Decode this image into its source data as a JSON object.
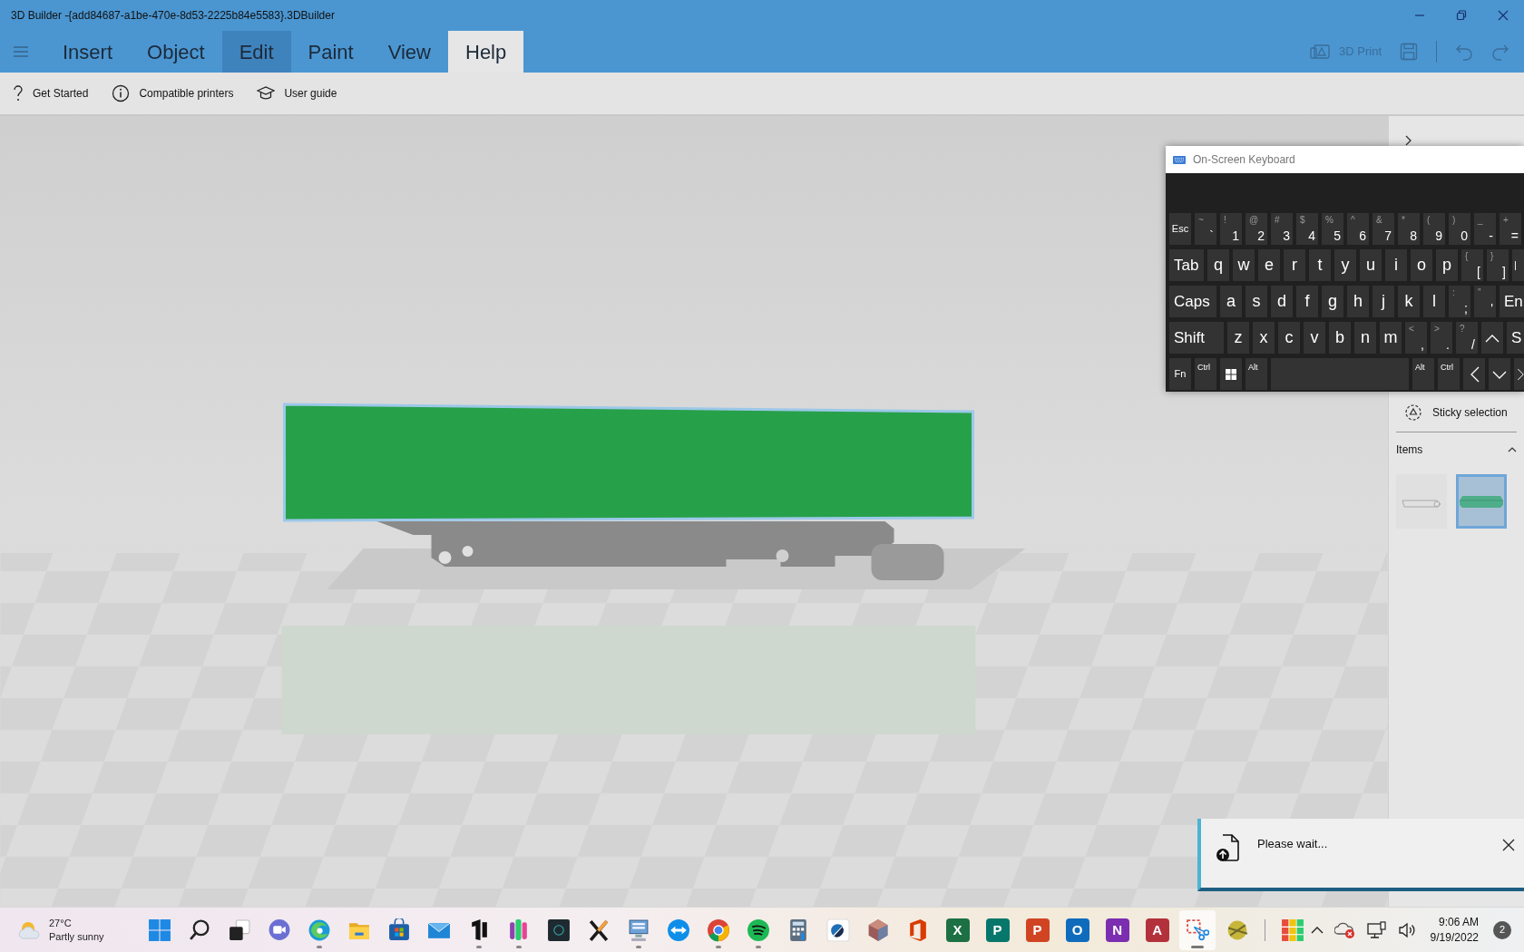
{
  "window": {
    "title": "3D Builder -{add84687-a1be-470e-8d53-2225b84e5583}.3DBuilder"
  },
  "tabs": [
    {
      "label": "Insert",
      "selected": false,
      "highlighted": false
    },
    {
      "label": "Object",
      "selected": false,
      "highlighted": false
    },
    {
      "label": "Edit",
      "selected": false,
      "highlighted": true
    },
    {
      "label": "Paint",
      "selected": false,
      "highlighted": false
    },
    {
      "label": "View",
      "selected": false,
      "highlighted": false
    },
    {
      "label": "Help",
      "selected": true,
      "highlighted": false
    }
  ],
  "quick_actions": [
    {
      "kind": "print",
      "label": "3D Print",
      "disabled": true
    },
    {
      "kind": "save",
      "disabled": true
    },
    {
      "kind": "undo",
      "disabled": true
    },
    {
      "kind": "redo",
      "disabled": true
    }
  ],
  "toolbar": [
    {
      "kind": "help",
      "label": "Get Started"
    },
    {
      "kind": "info",
      "label": "Compatible printers"
    },
    {
      "kind": "guide",
      "label": "User guide"
    }
  ],
  "side_panel": {
    "option": "Sticky selection",
    "items_title": "Items",
    "items_expanded": true,
    "items": [
      {
        "kind": "car",
        "selected": false
      },
      {
        "kind": "block",
        "selected": true
      }
    ]
  },
  "keyboard": {
    "title": "On-Screen Keyboard",
    "rows": [
      [
        {
          "kind": "small",
          "label": "Esc"
        },
        {
          "kind": "dual",
          "shift": "~",
          "label": "`"
        },
        {
          "kind": "dual",
          "shift": "!",
          "label": "1"
        },
        {
          "kind": "dual",
          "shift": "@",
          "label": "2"
        },
        {
          "kind": "dual",
          "shift": "#",
          "label": "3"
        },
        {
          "kind": "dual",
          "shift": "$",
          "label": "4"
        },
        {
          "kind": "dual",
          "shift": "%",
          "label": "5"
        },
        {
          "kind": "dual",
          "shift": "^",
          "label": "6"
        },
        {
          "kind": "dual",
          "shift": "&",
          "label": "7"
        },
        {
          "kind": "dual",
          "shift": "*",
          "label": "8"
        },
        {
          "kind": "dual",
          "shift": "(",
          "label": "9"
        },
        {
          "kind": "dual",
          "shift": ")",
          "label": "0"
        },
        {
          "kind": "dual",
          "shift": "_",
          "label": "-"
        },
        {
          "kind": "dual",
          "shift": "+",
          "label": "="
        }
      ],
      [
        {
          "kind": "mod",
          "label": "Tab"
        },
        {
          "kind": "letter",
          "label": "q"
        },
        {
          "kind": "letter",
          "label": "w"
        },
        {
          "kind": "letter",
          "label": "e"
        },
        {
          "kind": "letter",
          "label": "r"
        },
        {
          "kind": "letter",
          "label": "t"
        },
        {
          "kind": "letter",
          "label": "y"
        },
        {
          "kind": "letter",
          "label": "u"
        },
        {
          "kind": "letter",
          "label": "i"
        },
        {
          "kind": "letter",
          "label": "o"
        },
        {
          "kind": "letter",
          "label": "p"
        },
        {
          "kind": "dual",
          "shift": "{",
          "label": "["
        },
        {
          "kind": "dual",
          "shift": "}",
          "label": "]"
        },
        {
          "kind": "small",
          "label": "|"
        }
      ],
      [
        {
          "kind": "mod",
          "label": "Caps"
        },
        {
          "kind": "letter",
          "label": "a"
        },
        {
          "kind": "letter",
          "label": "s"
        },
        {
          "kind": "letter",
          "label": "d"
        },
        {
          "kind": "letter",
          "label": "f"
        },
        {
          "kind": "letter",
          "label": "g"
        },
        {
          "kind": "letter",
          "label": "h"
        },
        {
          "kind": "letter",
          "label": "j"
        },
        {
          "kind": "letter",
          "label": "k"
        },
        {
          "kind": "letter",
          "label": "l"
        },
        {
          "kind": "dual",
          "shift": ":",
          "label": ";"
        },
        {
          "kind": "dual",
          "shift": "\"",
          "label": "'"
        },
        {
          "kind": "mod",
          "label": "En"
        }
      ],
      [
        {
          "kind": "mod",
          "label": "Shift"
        },
        {
          "kind": "letter",
          "label": "z"
        },
        {
          "kind": "letter",
          "label": "x"
        },
        {
          "kind": "letter",
          "label": "c"
        },
        {
          "kind": "letter",
          "label": "v"
        },
        {
          "kind": "letter",
          "label": "b"
        },
        {
          "kind": "letter",
          "label": "n"
        },
        {
          "kind": "letter",
          "label": "m"
        },
        {
          "kind": "dual",
          "shift": "<",
          "label": ","
        },
        {
          "kind": "dual",
          "shift": ">",
          "label": "."
        },
        {
          "kind": "dual",
          "shift": "?",
          "label": "/"
        },
        {
          "kind": "up"
        },
        {
          "kind": "mod",
          "label": "S"
        }
      ],
      [
        {
          "kind": "small",
          "label": "Fn"
        },
        {
          "kind": "corner",
          "label": "Ctrl"
        },
        {
          "kind": "win"
        },
        {
          "kind": "corner",
          "label": "Alt"
        },
        {
          "kind": "space"
        },
        {
          "kind": "corner",
          "label": "Alt"
        },
        {
          "kind": "corner",
          "label": "Ctrl"
        },
        {
          "kind": "left"
        },
        {
          "kind": "down"
        },
        {
          "kind": "right"
        }
      ]
    ]
  },
  "notification": {
    "message": "Please wait..."
  },
  "taskbar": {
    "weather": {
      "temperature": "27°C",
      "condition": "Partly sunny"
    },
    "apps": [
      {
        "kind": "start",
        "running": false,
        "active": false
      },
      {
        "kind": "search",
        "running": false,
        "active": false
      },
      {
        "kind": "taskview",
        "running": false,
        "active": false
      },
      {
        "kind": "chat",
        "running": false,
        "active": false
      },
      {
        "kind": "browser",
        "running": true,
        "active": false
      },
      {
        "kind": "folder",
        "running": false,
        "active": false
      },
      {
        "kind": "store",
        "running": false,
        "active": false
      },
      {
        "kind": "mail",
        "running": false,
        "active": false
      },
      {
        "kind": "bracket",
        "running": true,
        "active": false
      },
      {
        "kind": "columns",
        "running": true,
        "active": false
      },
      {
        "kind": "darktile",
        "running": false,
        "active": false
      },
      {
        "kind": "cross",
        "running": false,
        "active": false
      },
      {
        "kind": "monitor",
        "running": true,
        "active": false
      },
      {
        "kind": "arrows",
        "running": false,
        "active": false
      },
      {
        "kind": "ring",
        "running": true,
        "active": false
      },
      {
        "kind": "waves",
        "running": true,
        "active": false
      },
      {
        "kind": "calculator",
        "running": false,
        "active": false
      },
      {
        "kind": "halfcircle",
        "running": false,
        "active": false
      },
      {
        "kind": "gem",
        "running": false,
        "active": false
      },
      {
        "kind": "door",
        "running": false,
        "active": false
      },
      {
        "kind": "tile",
        "glyph": "X",
        "color": "#1d7044",
        "running": false,
        "active": false
      },
      {
        "kind": "tile",
        "glyph": "P",
        "color": "#07776b",
        "running": false,
        "active": false
      },
      {
        "kind": "tile",
        "glyph": "P",
        "color": "#d04423",
        "running": false,
        "active": false
      },
      {
        "kind": "tile",
        "glyph": "O",
        "color": "#0f6cbd",
        "running": false,
        "active": false
      },
      {
        "kind": "tile",
        "glyph": "N",
        "color": "#7b2eb0",
        "running": false,
        "active": false
      },
      {
        "kind": "tile",
        "glyph": "A",
        "color": "#b3313b",
        "running": false,
        "active": false
      },
      {
        "kind": "scissors",
        "running": true,
        "active": true
      },
      {
        "kind": "ball",
        "running": false,
        "active": false
      },
      {
        "kind": "divider"
      },
      {
        "kind": "grid",
        "running": false,
        "active": false
      }
    ],
    "time": "9:06 AM",
    "date": "9/19/2022",
    "badge": "2"
  }
}
